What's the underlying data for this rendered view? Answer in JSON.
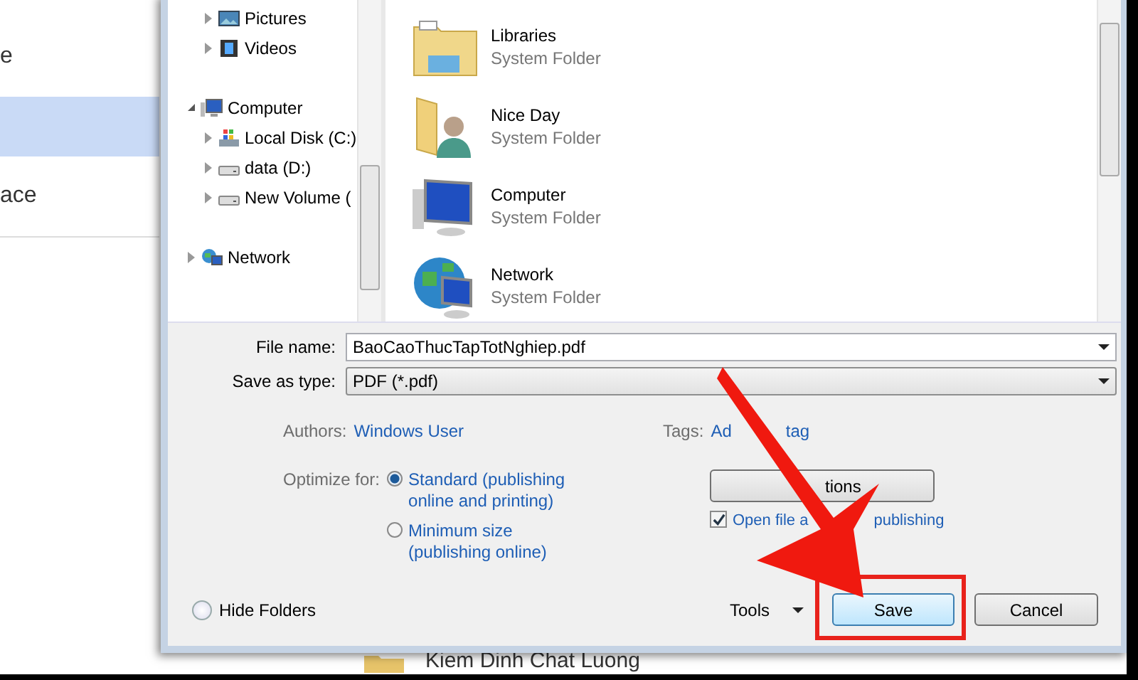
{
  "background_window": {
    "nav_items": [
      {
        "label": "e",
        "selected": false
      },
      {
        "selected": true
      },
      {
        "label": "ace",
        "selected": false
      }
    ],
    "footer_item": "Kiem Dinh Chat Luong"
  },
  "dialog": {
    "nav_tree": {
      "library_children": [
        {
          "label": "Pictures",
          "kind": "pictures",
          "expanded": false
        },
        {
          "label": "Videos",
          "kind": "videos",
          "expanded": false
        }
      ],
      "roots": [
        {
          "label": "Computer",
          "kind": "computer",
          "expanded": true,
          "children": [
            {
              "label": "Local Disk (C:)",
              "kind": "system-drive",
              "expanded": false
            },
            {
              "label": "data (D:)",
              "kind": "drive",
              "expanded": false
            },
            {
              "label": "New Volume (",
              "kind": "drive",
              "expanded": false
            }
          ]
        },
        {
          "label": "Network",
          "kind": "network",
          "expanded": false
        }
      ]
    },
    "items": [
      {
        "name": "Libraries",
        "subtitle": "System Folder",
        "kind": "libraries"
      },
      {
        "name": "Nice Day",
        "subtitle": "System Folder",
        "kind": "user-folder"
      },
      {
        "name": "Computer",
        "subtitle": "System Folder",
        "kind": "computer"
      },
      {
        "name": "Network",
        "subtitle": "System Folder",
        "kind": "network"
      }
    ],
    "file_name": {
      "label": "File name:",
      "value": "BaoCaoThucTapTotNghiep.pdf"
    },
    "save_as_type": {
      "label": "Save as type:",
      "value": "PDF (*.pdf)"
    },
    "authors": {
      "label": "Authors:",
      "value": "Windows User"
    },
    "tags": {
      "label": "Tags:",
      "value_parts": [
        "Ad",
        "tag"
      ]
    },
    "optimize": {
      "label": "Optimize for:",
      "options": [
        {
          "label": "Standard (publishing online and printing)",
          "selected": true
        },
        {
          "label": "Minimum size (publishing online)",
          "selected": false
        }
      ]
    },
    "options_button": "tions",
    "open_after": {
      "label_parts": [
        "Open file a",
        "publishing"
      ],
      "checked": true
    },
    "hide_folders": "Hide Folders",
    "tools": "Tools",
    "save": "Save",
    "cancel": "Cancel"
  }
}
